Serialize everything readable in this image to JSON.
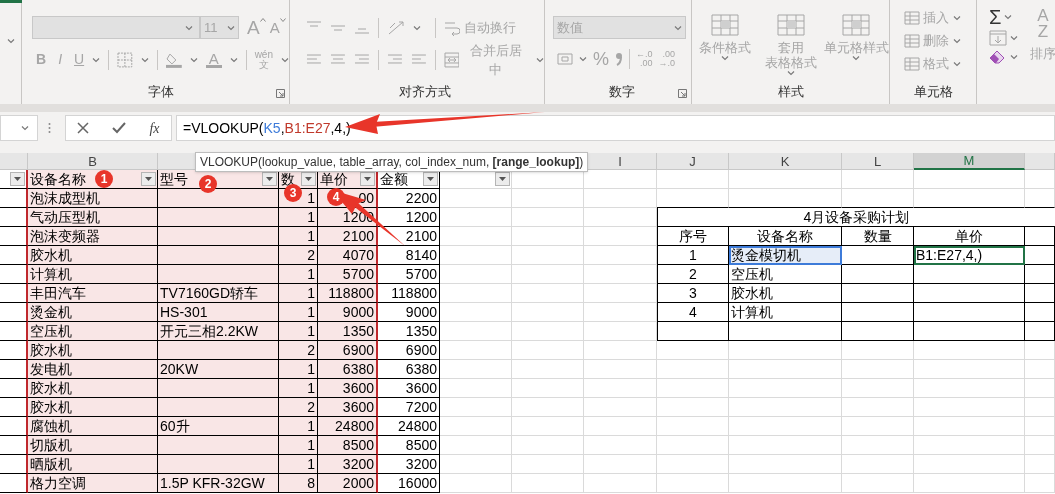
{
  "ribbon": {
    "groups": [
      {
        "kind": "font",
        "label": "字体",
        "disabled": true,
        "font_size": "11",
        "grow": "A",
        "shrink": "A",
        "bold": "B",
        "italic": "I",
        "underline": "U",
        "font_color": "A",
        "phonetic_top": "wén",
        "phonetic_bottom": "文"
      },
      {
        "kind": "alignment",
        "label": "对齐方式",
        "disabled": true,
        "wrap": "自动换行",
        "merge": "合并后居中"
      },
      {
        "kind": "number",
        "label": "数字",
        "disabled": true,
        "format": "数值",
        "percent": "%",
        "increase_decimal": [
          "←.0",
          ".00"
        ],
        "decrease_decimal": [
          ".00",
          "→.0"
        ]
      },
      {
        "kind": "styles",
        "label": "样式",
        "disabled": true,
        "buttons": [
          {
            "lines": [
              "条件格式"
            ]
          },
          {
            "lines": [
              "套用",
              "表格格式"
            ]
          },
          {
            "lines": [
              "单元格样式"
            ]
          }
        ]
      },
      {
        "kind": "cells",
        "label": "单元格",
        "disabled": true,
        "buttons": [
          "插入",
          "删除",
          "格式"
        ]
      },
      {
        "kind": "editing",
        "sum": {
          "symbol": "Σ",
          "disabled": false
        },
        "sort": {
          "top": "A",
          "bottom": "Z",
          "label": "排序",
          "disabled": true
        }
      }
    ]
  },
  "formula_bar": {
    "insert_function": "fx",
    "formula": [
      {
        "text": "=VLOOKUP("
      },
      {
        "text": "K5",
        "color": "#3d7bd9"
      },
      {
        "text": ","
      },
      {
        "text": "B1:E27",
        "color": "#c0392b"
      },
      {
        "text": ",4,)"
      }
    ],
    "tooltip": "VLOOKUP(lookup_value, table_array, col_index_num, **[range_lookup]**)"
  },
  "column_headers": [
    {
      "letter": "B",
      "selected": false
    },
    {
      "letter": "I",
      "selected": false
    },
    {
      "letter": "J",
      "selected": false
    },
    {
      "letter": "K",
      "selected": false
    },
    {
      "letter": "L",
      "selected": false
    },
    {
      "letter": "M",
      "selected": true
    }
  ],
  "equipment_table": {
    "headers": [
      "设备名称",
      "型号",
      "数",
      "单价",
      "金额"
    ],
    "rows": [
      [
        "泡沫成型机",
        "",
        "1",
        "00",
        "2200"
      ],
      [
        "气动压型机",
        "",
        "1",
        "1200",
        "1200"
      ],
      [
        "泡沫变频器",
        "",
        "1",
        "2100",
        "2100"
      ],
      [
        "胶水机",
        "",
        "2",
        "4070",
        "8140"
      ],
      [
        "计算机",
        "",
        "1",
        "5700",
        "5700"
      ],
      [
        "丰田汽车",
        "TV7160GD轿车",
        "1",
        "118800",
        "118800"
      ],
      [
        "烫金机",
        "HS-301",
        "1",
        "9000",
        "9000"
      ],
      [
        "空压机",
        "开元三相2.2KW",
        "1",
        "1350",
        "1350"
      ],
      [
        "胶水机",
        "",
        "2",
        "6900",
        "6900"
      ],
      [
        "发电机",
        "20KW",
        "1",
        "6380",
        "6380"
      ],
      [
        "胶水机",
        "",
        "1",
        "3600",
        "3600"
      ],
      [
        "胶水机",
        "",
        "2",
        "3600",
        "7200"
      ],
      [
        "腐蚀机",
        "60升",
        "1",
        "24800",
        "24800"
      ],
      [
        "切版机",
        "",
        "1",
        "8500",
        "8500"
      ],
      [
        "晒版机",
        "",
        "1",
        "3200",
        "3200"
      ],
      [
        "格力空调",
        "1.5P KFR-32GW",
        "8",
        "2000",
        "16000"
      ]
    ]
  },
  "plan_table": {
    "title": "4月设备采购计划",
    "headers": [
      "序号",
      "设备名称",
      "数量",
      "单价"
    ],
    "rows": [
      {
        "no": "1",
        "name": "烫金模切机",
        "price": "B1:E27,4,)",
        "name_highlighted": true,
        "price_editing": true
      },
      {
        "no": "2",
        "name": "空压机",
        "name_highlighted": false,
        "price_editing": false
      },
      {
        "no": "3",
        "name": "胶水机",
        "name_highlighted": false,
        "price_editing": false
      },
      {
        "no": "4",
        "name": "计算机",
        "name_highlighted": false,
        "price_editing": false
      }
    ]
  },
  "annotations": [
    "1",
    "2",
    "3",
    "4"
  ]
}
